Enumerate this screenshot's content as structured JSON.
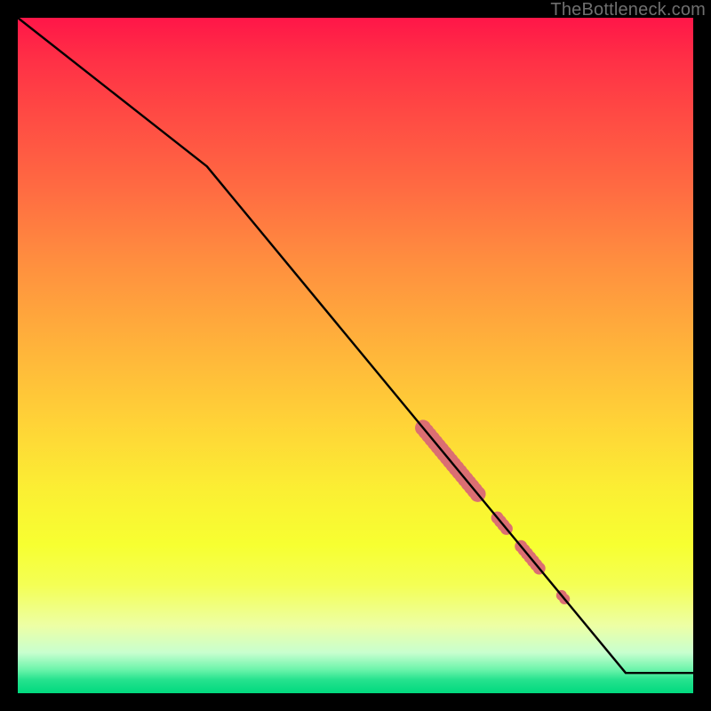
{
  "watermark": {
    "text": "TheBottleneck.com"
  },
  "chart_data": {
    "type": "line",
    "title": "",
    "xlabel": "",
    "ylabel": "",
    "xlim": [
      0,
      100
    ],
    "ylim": [
      0,
      100
    ],
    "grid": false,
    "series": [
      {
        "name": "curve",
        "x": [
          0,
          28,
          90,
          100
        ],
        "values": [
          100,
          78,
          3,
          3
        ]
      }
    ],
    "markers": {
      "name": "highlight-points",
      "on_series": "curve",
      "color": "#db6e72",
      "segments": [
        {
          "x_start": 60.0,
          "x_end": 68.5,
          "radius": 9
        },
        {
          "x_start": 71.0,
          "x_end": 72.5,
          "radius": 7
        },
        {
          "x_start": 74.5,
          "x_end": 77.5,
          "radius": 7
        },
        {
          "x_start": 80.5,
          "x_end": 81.0,
          "radius": 6
        }
      ]
    }
  }
}
